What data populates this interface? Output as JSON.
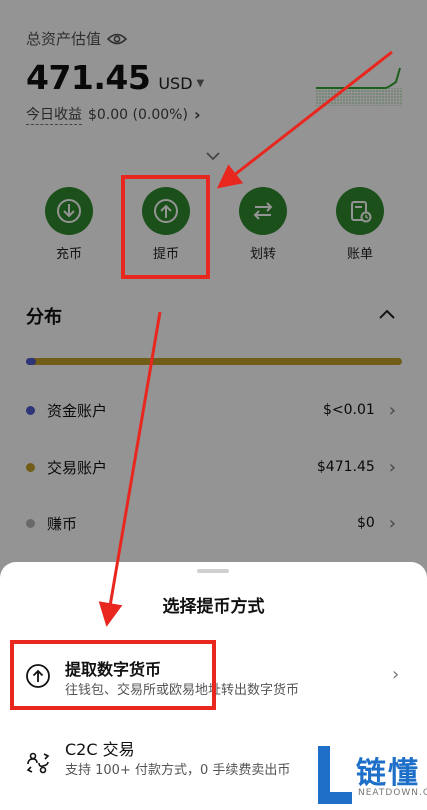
{
  "header": {
    "asset_label": "总资产估值",
    "balance_value": "471.45",
    "balance_unit": "USD",
    "today_label": "今日收益",
    "today_value": "$0.00 (0.00%)"
  },
  "actions": [
    {
      "label": "充币",
      "icon": "deposit-icon"
    },
    {
      "label": "提币",
      "icon": "withdraw-icon"
    },
    {
      "label": "划转",
      "icon": "transfer-icon"
    },
    {
      "label": "账单",
      "icon": "bill-icon"
    }
  ],
  "distribution": {
    "title": "分布",
    "accounts": [
      {
        "name": "资金账户",
        "value": "$<0.01",
        "color": "#4f5ccf"
      },
      {
        "name": "交易账户",
        "value": "$471.45",
        "color": "#c5a02a"
      },
      {
        "name": "赚币",
        "value": "$0",
        "color": "#b5b5b5"
      }
    ]
  },
  "sheet": {
    "title": "选择提币方式",
    "options": [
      {
        "title": "提取数字货币",
        "desc": "往钱包、交易所或欧易地址转出数字货币",
        "icon": "withdraw-icon"
      },
      {
        "title": "C2C 交易",
        "desc": "支持 100+ 付款方式，0 手续费卖出币",
        "icon": "c2c-icon"
      }
    ]
  },
  "watermark": {
    "text": "链懂",
    "sub": "NEATDOWN.COM"
  },
  "colors": {
    "accent_green": "#2f8a2f",
    "annotation_red": "#e8271f",
    "brand_blue": "#1e6fc8"
  }
}
